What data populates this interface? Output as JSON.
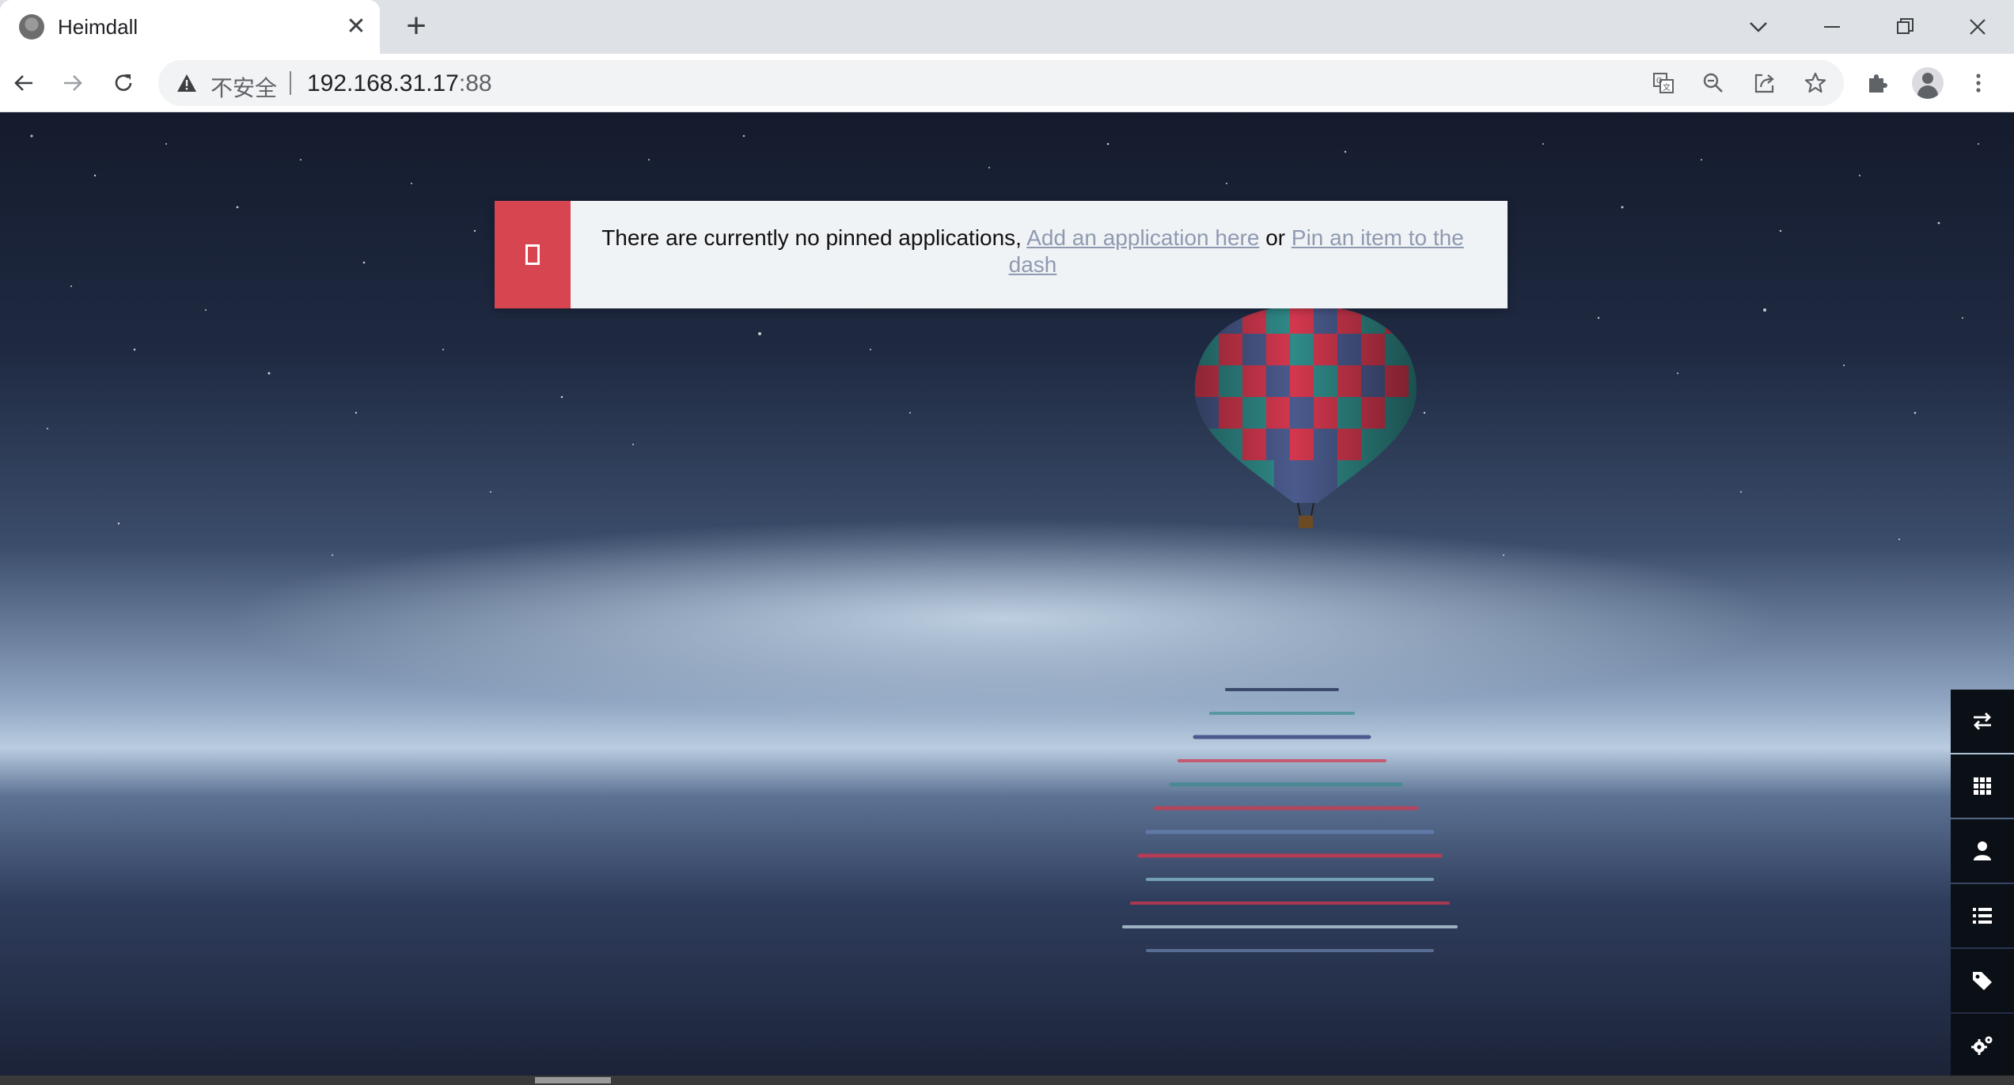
{
  "browser": {
    "tab": {
      "title": "Heimdall",
      "close": "✕"
    },
    "new_tab": "+",
    "address": {
      "security_label": "不安全",
      "host": "192.168.31.17",
      "port": ":88"
    }
  },
  "notice": {
    "text_before": "There are currently no pinned applications, ",
    "link_add": "Add an application here",
    "text_mid": " or ",
    "link_pin": "Pin an item to the dash"
  },
  "sidebar": {
    "buttons": [
      "switch-view",
      "applications",
      "users",
      "items-list",
      "tags",
      "settings"
    ]
  },
  "colors": {
    "accent_red": "#d64550",
    "link": "#8f9ab0",
    "sidebar_bg": "#0b0f16"
  }
}
